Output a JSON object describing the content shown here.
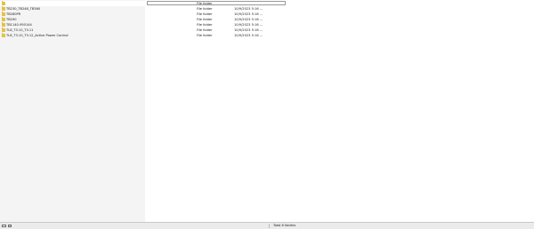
{
  "file_list": {
    "selected_row": {
      "name": "",
      "type": "File folder",
      "date": ""
    },
    "rows": [
      {
        "name": "TB230_TB248_TB360",
        "type": "File folder",
        "date": "10/9/2023 5:16 ..."
      },
      {
        "name": "TB280PR",
        "type": "File folder",
        "date": "10/9/2023 5:16 ..."
      },
      {
        "name": "TB290",
        "type": "File folder",
        "date": "10/9/2023 5:16 ..."
      },
      {
        "name": "TB1140-950144",
        "type": "File folder",
        "date": "10/9/2023 5:16 ..."
      },
      {
        "name": "TL8_T3.10_T3.11",
        "type": "File folder",
        "date": "10/9/2023 5:16 ..."
      },
      {
        "name": "TL8_T3.10_T3.12_Active Power Control",
        "type": "File folder",
        "date": "10/9/2023 5:16 ..."
      }
    ]
  },
  "statusbar": {
    "summary": "Total 6 folders"
  },
  "icons": {
    "folder": "folder-icon",
    "view_toggle": "list-view-icon",
    "details_toggle": "details-view-icon"
  },
  "colors": {
    "folder": "#e8c048",
    "name_column_background": "#f4f4f4",
    "statusbar": "#ebebeb"
  }
}
